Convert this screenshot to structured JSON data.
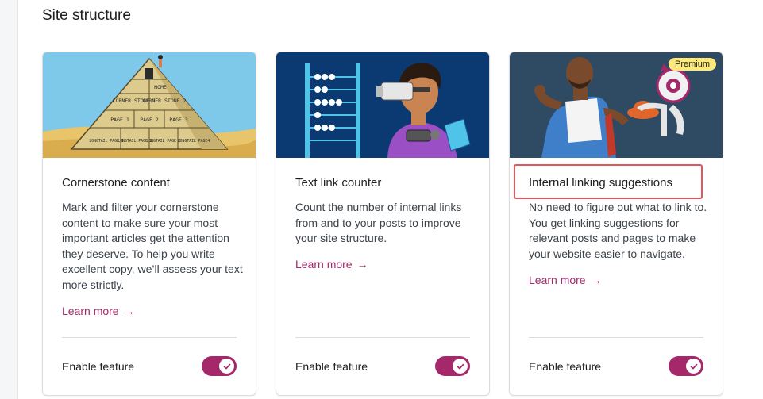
{
  "section": {
    "title": "Site structure"
  },
  "cards": [
    {
      "title": "Cornerstone content",
      "description": "Mark and filter your cornerstone content to make sure your most important articles get the attention they deserve. To help you write excellent copy, we’ll assess your text more strictly.",
      "learn_more": "Learn more",
      "enable_label": "Enable feature",
      "enabled": true,
      "illustration": "pyramid-illustration",
      "pyramid_labels": [
        "HOME",
        "CORNER STONE 1",
        "CORNER STONE 2",
        "PAGE 1",
        "PAGE 2",
        "PAGE 3",
        "LONGTAIL PAGE 1",
        "LONGTAIL PAGE 2",
        "LONGTAIL PAGE 3",
        "LONGTAIL PAGE4"
      ]
    },
    {
      "title": "Text link counter",
      "description": "Count the number of internal links from and to your posts to improve your site structure.",
      "learn_more": "Learn more",
      "enable_label": "Enable feature",
      "enabled": true,
      "illustration": "vr-abacus-illustration"
    },
    {
      "title": "Internal linking suggestions",
      "description": "No need to figure out what to link to. You get linking suggestions for relevant posts and pages to make your website easier to navigate.",
      "learn_more": "Learn more",
      "enable_label": "Enable feature",
      "enabled": true,
      "badge": "Premium",
      "illustration": "robot-illustration"
    }
  ],
  "colors": {
    "brand": "#a4286a",
    "badge": "#fdea7a",
    "highlight": "#e1575a",
    "text_muted": "#3c434a"
  },
  "icons": {
    "arrow": "→",
    "check": "check-icon"
  }
}
